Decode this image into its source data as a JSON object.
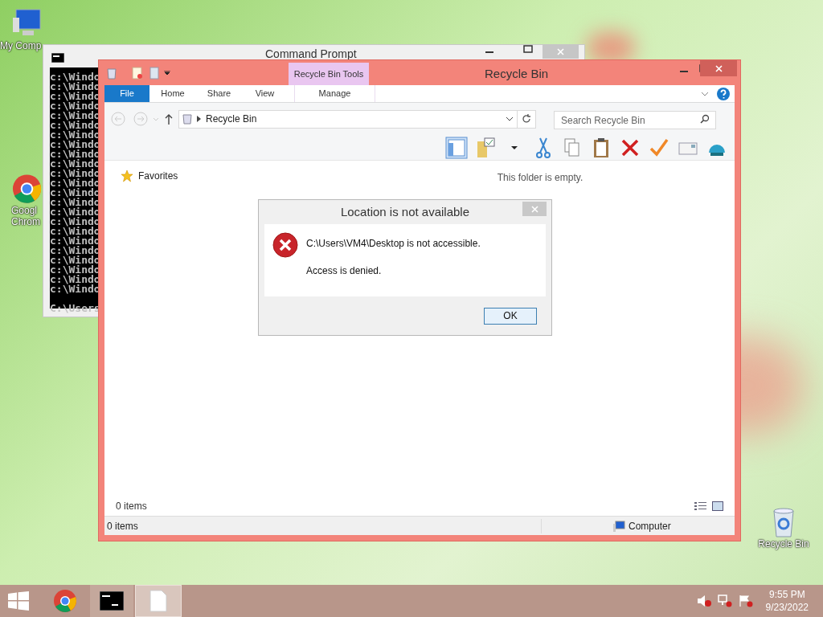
{
  "desktop_icons": [
    {
      "label": "My Comp",
      "kind": "computer"
    },
    {
      "label": "Googl\nChrom",
      "kind": "chrome"
    },
    {
      "label": "Recycle Bin",
      "kind": "bin"
    }
  ],
  "command_prompt": {
    "title": "Command Prompt",
    "lines": [
      "c:\\Windo",
      "c:\\Windo",
      "c:\\Windo",
      "c:\\Windo",
      "c:\\Windo",
      "c:\\Windo",
      "c:\\Windo",
      "c:\\Windo",
      "c:\\Windo",
      "c:\\Windo",
      "c:\\Windo",
      "c:\\Windo",
      "c:\\Windo",
      "c:\\Windo",
      "c:\\Windo",
      "c:\\Windo",
      "c:\\Windo",
      "c:\\Windo",
      "c:\\Windo",
      "c:\\Windo",
      "c:\\Windo",
      "c:\\Windo",
      "c:\\Windo"
    ],
    "prompt": "C:\\Users"
  },
  "explorer": {
    "title": "Recycle Bin",
    "contextual_group": "Recycle Bin Tools",
    "file_tab": "File",
    "tabs": [
      {
        "label": "Home",
        "selected": false
      },
      {
        "label": "Share",
        "selected": false
      },
      {
        "label": "View",
        "selected": false
      },
      {
        "label": "Manage",
        "selected": false
      }
    ],
    "address": "Recycle Bin",
    "search": {
      "placeholder": "Search Recycle Bin"
    },
    "nav_items": [
      {
        "label": "Favorites"
      }
    ],
    "empty_message": "This folder is empty.",
    "item_count": "0 items",
    "status_bar": {
      "left": "0 items",
      "right": "Computer"
    }
  },
  "dialog": {
    "title": "Location is not available",
    "message": "C:\\Users\\VM4\\Desktop is not accessible.",
    "detail": "Access is denied.",
    "button": "OK"
  },
  "taskbar": {
    "time": "9:55 PM",
    "date": "9/23/2022"
  }
}
